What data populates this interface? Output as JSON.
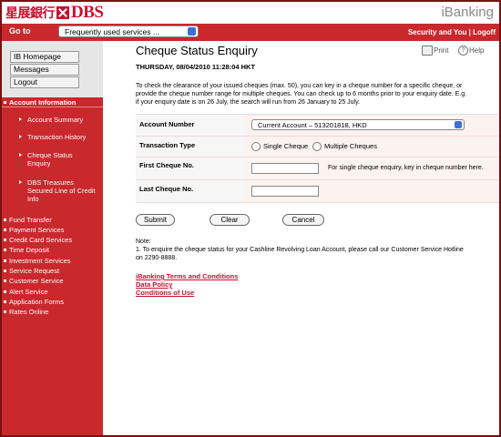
{
  "header": {
    "logo_cn": "星展銀行",
    "logo_en": "DBS",
    "product": "iBanking"
  },
  "topbar": {
    "goto_label": "Go to",
    "goto_select": "Frequently used services ...",
    "links": "Security and You | Logoff"
  },
  "sidebar": {
    "buttons": [
      "IB Homepage",
      "Messages",
      "Logout"
    ],
    "section": "Account Information",
    "subitems": [
      "Account Summary",
      "Transaction History",
      "Cheque Status Enquiry",
      "DBS Treasures Secured Line of Credit Info"
    ],
    "items": [
      "Fund Transfer",
      "Payment Services",
      "Credit Card Services",
      "Time Deposit",
      "Investment Services",
      "Service Request",
      "Customer Service",
      "Alert Service",
      "Application Forms",
      "Rates Online"
    ]
  },
  "main": {
    "title": "Cheque Status Enquiry",
    "print_label": "Print",
    "help_label": "Help",
    "date": "THURSDAY, 08/04/2010 11:28:04 HKT",
    "intro_lines": [
      "To check the clearance of your issued cheques (max. 50), you can key in a cheque number for a specific cheque, or",
      "provide the cheque number range for multiple cheques. You can check up to 6 months prior to your enquiry date. E.g.",
      "if your enquiry date is on 26 July, the search will run from 26 January to 25 July."
    ],
    "form": {
      "account_label": "Account Number",
      "account_value": "Current Account – 513201818, HKD",
      "type_label": "Transaction Type",
      "single_label": "Single Cheque",
      "multiple_label": "Multiple Cheques",
      "first_label": "First Cheque No.",
      "first_hint": "For single cheque enquiry, key in cheque number here.",
      "last_label": "Last Cheque No."
    },
    "buttons": {
      "submit": "Submit",
      "clear": "Clear",
      "cancel": "Cancel"
    },
    "note_title": "Note:",
    "note_lines": [
      "1.   To enquire the cheque status for your Cashline Revolving Loan Account, please call our Customer Service Hotline",
      "      on 2290-8888."
    ],
    "links": [
      "iBanking Terms and Conditions",
      "Data Policy",
      "Conditions of Use"
    ]
  }
}
